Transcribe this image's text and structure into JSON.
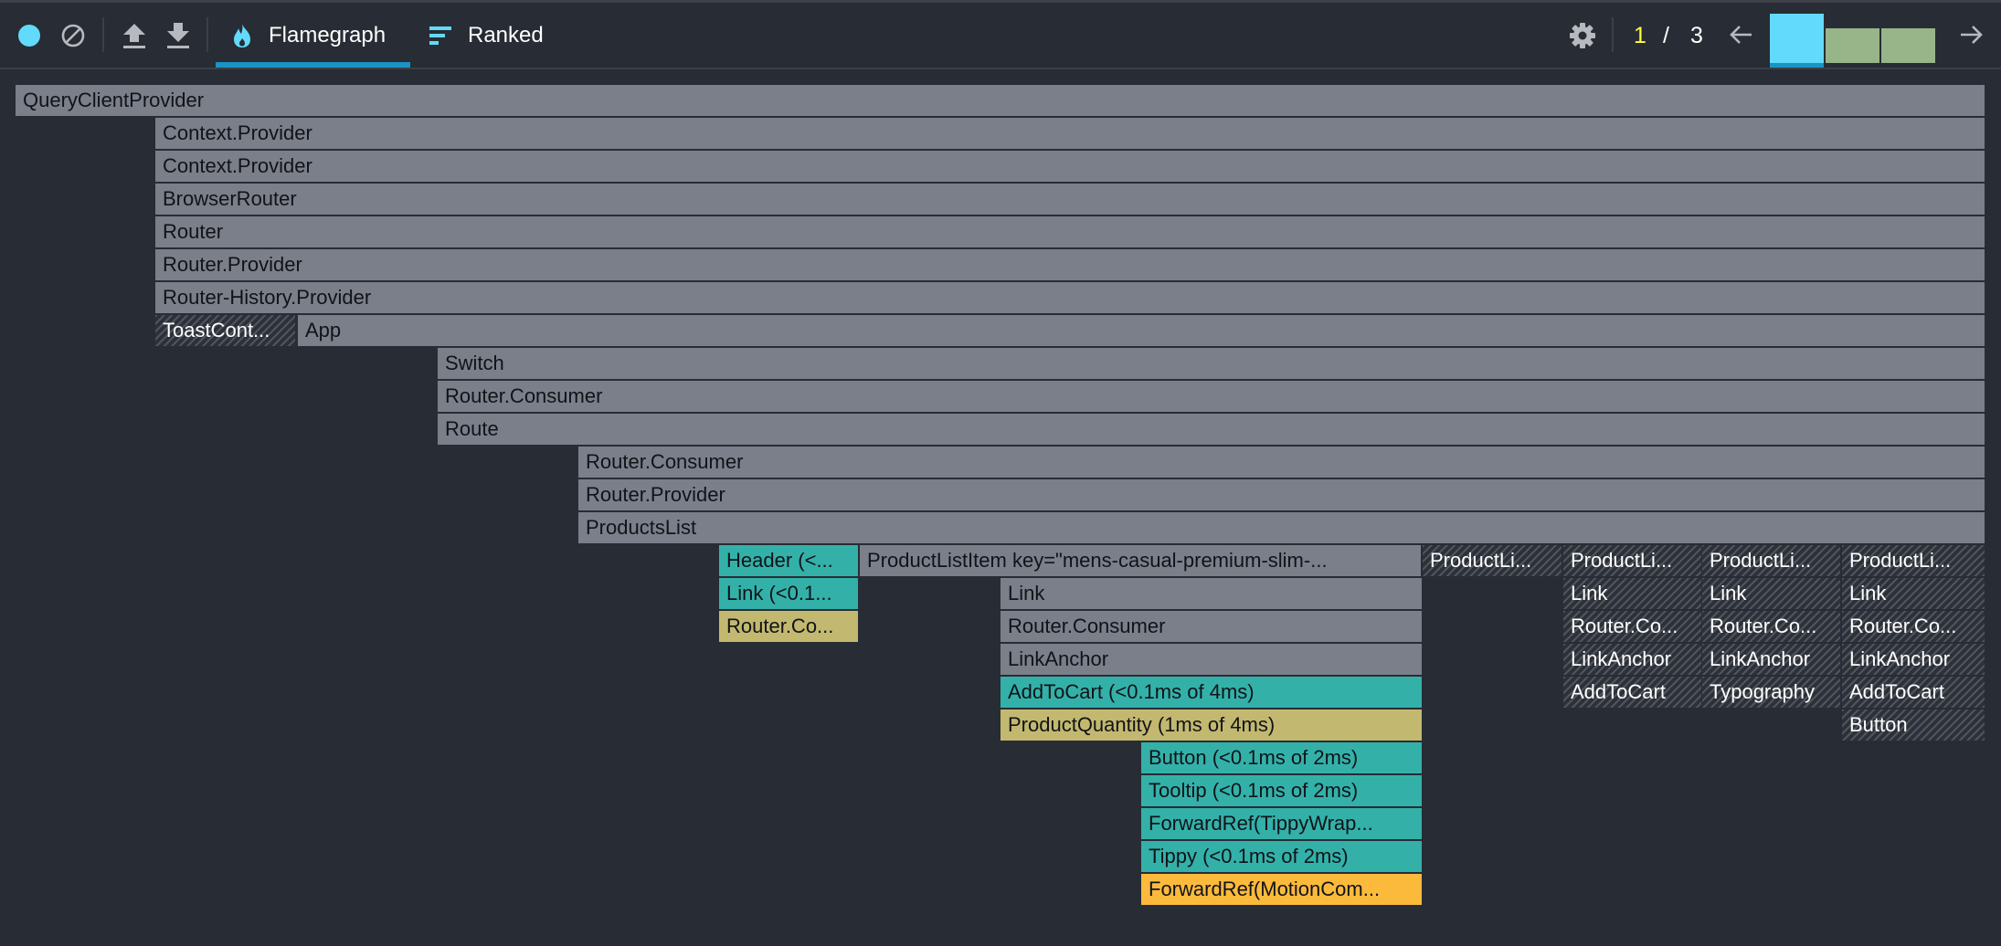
{
  "toolbar": {
    "record_icon": "record-circle-icon",
    "clear_icon": "clear-icon",
    "upload_icon": "upload-icon",
    "download_icon": "download-icon",
    "tabs": [
      {
        "label": "Flamegraph",
        "icon": "flame-icon",
        "active": true
      },
      {
        "label": "Ranked",
        "icon": "ranked-bars-icon",
        "active": false
      }
    ],
    "settings_icon": "gear-icon",
    "commit_pager": {
      "current": "1",
      "separator": "/",
      "total": "3"
    },
    "prev_icon": "arrow-left-icon",
    "next_icon": "arrow-right-icon",
    "commits": [
      {
        "relative_duration": 1.0,
        "selected": true,
        "color": "#61dafb"
      },
      {
        "relative_duration": 0.7,
        "selected": false,
        "color": "#98b589"
      },
      {
        "relative_duration": 0.7,
        "selected": false,
        "color": "#98b589"
      }
    ]
  },
  "colors": {
    "background": "#282c34",
    "accent": "#61dafb",
    "tab_underline": "#1b93c4",
    "page_current": "#ffff3c",
    "bar_gray": "#7b7f8a",
    "bar_teal": "#33b1a9",
    "bar_khaki": "#c3b86f",
    "bar_orange": "#fcba3c"
  },
  "flamegraph": {
    "nodes": [
      {
        "label": "QueryClientProvider",
        "depth": 0,
        "start": 0.0,
        "end": 1.0,
        "kind": "gray"
      },
      {
        "label": "Context.Provider",
        "depth": 1,
        "start": 0.0712,
        "end": 1.0,
        "kind": "gray"
      },
      {
        "label": "Context.Provider",
        "depth": 2,
        "start": 0.0712,
        "end": 1.0,
        "kind": "gray"
      },
      {
        "label": "BrowserRouter",
        "depth": 3,
        "start": 0.0712,
        "end": 1.0,
        "kind": "gray"
      },
      {
        "label": "Router",
        "depth": 4,
        "start": 0.0712,
        "end": 1.0,
        "kind": "gray"
      },
      {
        "label": "Router.Provider",
        "depth": 5,
        "start": 0.0712,
        "end": 1.0,
        "kind": "gray"
      },
      {
        "label": "Router-History.Provider",
        "depth": 6,
        "start": 0.0712,
        "end": 1.0,
        "kind": "gray"
      },
      {
        "label": "ToastCont...",
        "depth": 7,
        "start": 0.0712,
        "end": 0.1423,
        "kind": "hatched"
      },
      {
        "label": "App",
        "depth": 7,
        "start": 0.1432,
        "end": 1.0,
        "kind": "gray"
      },
      {
        "label": "Switch",
        "depth": 8,
        "start": 0.2146,
        "end": 1.0,
        "kind": "gray"
      },
      {
        "label": "Router.Consumer",
        "depth": 9,
        "start": 0.2146,
        "end": 1.0,
        "kind": "gray"
      },
      {
        "label": "Route",
        "depth": 10,
        "start": 0.2146,
        "end": 1.0,
        "kind": "gray"
      },
      {
        "label": "Router.Consumer",
        "depth": 11,
        "start": 0.2859,
        "end": 1.0,
        "kind": "gray"
      },
      {
        "label": "Router.Provider",
        "depth": 12,
        "start": 0.2859,
        "end": 1.0,
        "kind": "gray"
      },
      {
        "label": "ProductsList",
        "depth": 13,
        "start": 0.2859,
        "end": 1.0,
        "kind": "gray"
      },
      {
        "label": "Header (<...",
        "depth": 14,
        "start": 0.3573,
        "end": 0.428,
        "kind": "teal"
      },
      {
        "label": "ProductListItem key=\"mens-casual-premium-slim-...",
        "depth": 14,
        "start": 0.429,
        "end": 0.7141,
        "kind": "gray"
      },
      {
        "label": "ProductLi...",
        "depth": 14,
        "start": 0.7147,
        "end": 0.7854,
        "kind": "hatched"
      },
      {
        "label": "ProductLi...",
        "depth": 14,
        "start": 0.786,
        "end": 0.8562,
        "kind": "hatched"
      },
      {
        "label": "ProductLi...",
        "depth": 14,
        "start": 0.8568,
        "end": 0.9271,
        "kind": "hatched"
      },
      {
        "label": "ProductLi...",
        "depth": 14,
        "start": 0.9277,
        "end": 1.0,
        "kind": "hatched"
      },
      {
        "label": "Link (<0.1...",
        "depth": 15,
        "start": 0.3573,
        "end": 0.428,
        "kind": "teal"
      },
      {
        "label": "Link",
        "depth": 15,
        "start": 0.5003,
        "end": 0.7141,
        "kind": "gray"
      },
      {
        "label": "Link",
        "depth": 15,
        "start": 0.786,
        "end": 0.8562,
        "kind": "hatched"
      },
      {
        "label": "Link",
        "depth": 15,
        "start": 0.8568,
        "end": 0.9271,
        "kind": "hatched"
      },
      {
        "label": "Link",
        "depth": 15,
        "start": 0.9277,
        "end": 1.0,
        "kind": "hatched"
      },
      {
        "label": "Router.Co...",
        "depth": 16,
        "start": 0.3573,
        "end": 0.428,
        "kind": "khaki"
      },
      {
        "label": "Router.Consumer",
        "depth": 16,
        "start": 0.5003,
        "end": 0.7141,
        "kind": "gray"
      },
      {
        "label": "Router.Co...",
        "depth": 16,
        "start": 0.786,
        "end": 0.8562,
        "kind": "hatched"
      },
      {
        "label": "Router.Co...",
        "depth": 16,
        "start": 0.8568,
        "end": 0.9271,
        "kind": "hatched"
      },
      {
        "label": "Router.Co...",
        "depth": 16,
        "start": 0.9277,
        "end": 1.0,
        "kind": "hatched"
      },
      {
        "label": "LinkAnchor",
        "depth": 17,
        "start": 0.5003,
        "end": 0.7141,
        "kind": "gray"
      },
      {
        "label": "LinkAnchor",
        "depth": 17,
        "start": 0.786,
        "end": 0.8562,
        "kind": "hatched"
      },
      {
        "label": "LinkAnchor",
        "depth": 17,
        "start": 0.8568,
        "end": 0.9271,
        "kind": "hatched"
      },
      {
        "label": "LinkAnchor",
        "depth": 17,
        "start": 0.9277,
        "end": 1.0,
        "kind": "hatched"
      },
      {
        "label": "AddToCart (<0.1ms of 4ms)",
        "depth": 18,
        "start": 0.5003,
        "end": 0.7141,
        "kind": "teal"
      },
      {
        "label": "AddToCart",
        "depth": 18,
        "start": 0.786,
        "end": 0.8562,
        "kind": "hatched"
      },
      {
        "label": "Typography",
        "depth": 18,
        "start": 0.8568,
        "end": 0.9271,
        "kind": "hatched"
      },
      {
        "label": "AddToCart",
        "depth": 18,
        "start": 0.9277,
        "end": 1.0,
        "kind": "hatched"
      },
      {
        "label": "ProductQuantity (1ms of 4ms)",
        "depth": 19,
        "start": 0.5003,
        "end": 0.7141,
        "kind": "khaki"
      },
      {
        "label": "Button",
        "depth": 19,
        "start": 0.9277,
        "end": 1.0,
        "kind": "hatched"
      },
      {
        "label": "Button (<0.1ms of 2ms)",
        "depth": 20,
        "start": 0.5716,
        "end": 0.7141,
        "kind": "teal"
      },
      {
        "label": "Tooltip (<0.1ms of 2ms)",
        "depth": 21,
        "start": 0.5716,
        "end": 0.7141,
        "kind": "teal"
      },
      {
        "label": "ForwardRef(TippyWrap...",
        "depth": 22,
        "start": 0.5716,
        "end": 0.7141,
        "kind": "teal"
      },
      {
        "label": "Tippy (<0.1ms of 2ms)",
        "depth": 23,
        "start": 0.5716,
        "end": 0.7141,
        "kind": "teal"
      },
      {
        "label": "ForwardRef(MotionCom...",
        "depth": 24,
        "start": 0.5716,
        "end": 0.7141,
        "kind": "orange"
      }
    ]
  }
}
